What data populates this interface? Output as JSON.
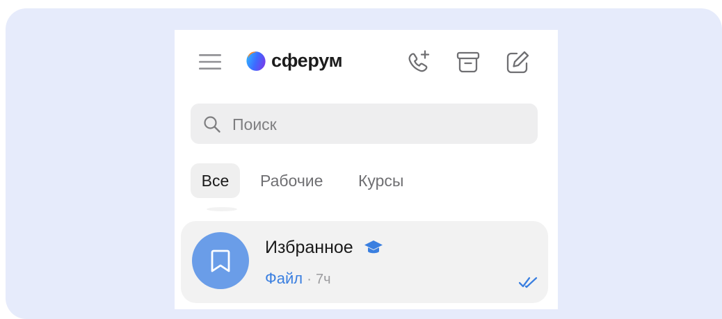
{
  "app": {
    "logo_text": "сферум"
  },
  "icons": {
    "menu": "hamburger-menu-icon",
    "add_call": "phone-plus-icon",
    "archive": "archive-box-icon",
    "compose": "compose-edit-icon",
    "search": "search-icon",
    "avatar": "bookmark-icon",
    "verified": "graduation-cap-icon",
    "read_status": "double-check-icon"
  },
  "search": {
    "placeholder": "Поиск"
  },
  "tabs": [
    {
      "label": "Все",
      "active": true
    },
    {
      "label": "Рабочие",
      "active": false
    },
    {
      "label": "Курсы",
      "active": false
    }
  ],
  "chats": [
    {
      "title": "Избранное",
      "preview_label": "Файл",
      "separator": "·",
      "time": "7ч"
    }
  ],
  "colors": {
    "background": "#e6ebfb",
    "accent": "#3a7fe0",
    "avatar": "#6a9de8",
    "icon_gray": "#6f6f72"
  }
}
